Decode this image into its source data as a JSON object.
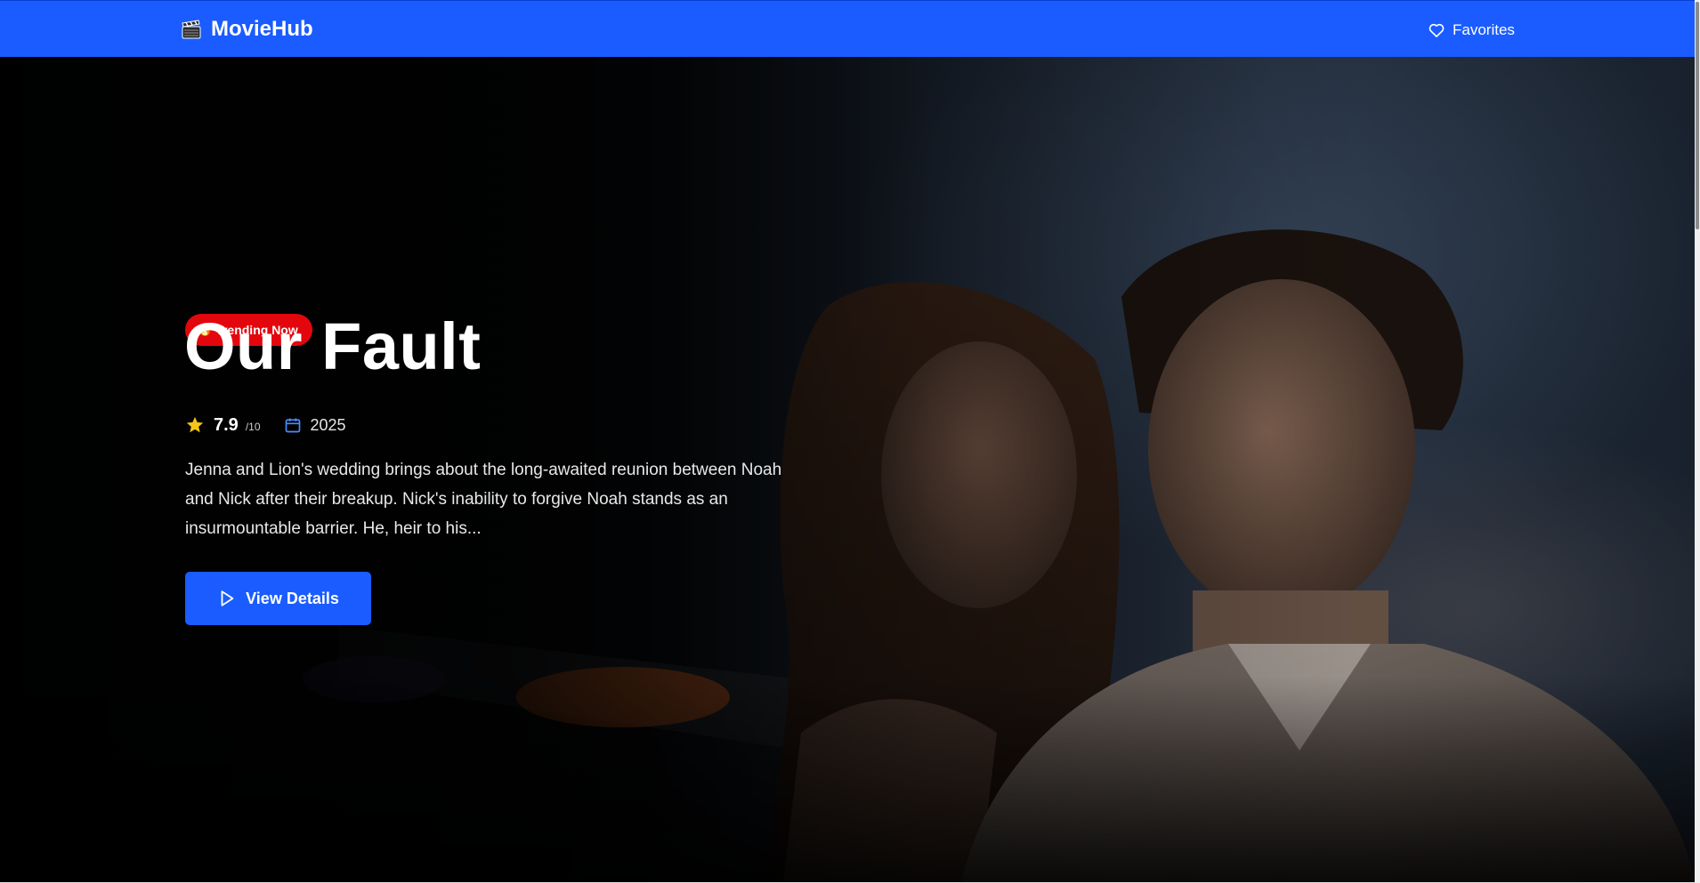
{
  "nav": {
    "brand": "MovieHub",
    "favorites_label": "Favorites"
  },
  "hero": {
    "badge": "Trending Now",
    "title": "Our Fault",
    "rating": "7.9",
    "rating_scale": "/10",
    "year": "2025",
    "description": "Jenna and Lion's wedding brings about the long-awaited reunion between Noah and Nick after their breakup. Nick's inability to forgive Noah stands as an insurmountable barrier. He, heir to his...",
    "cta_label": "View Details"
  },
  "icons": {
    "brand": "clapperboard-icon",
    "favorites": "heart-icon",
    "badge": "fire-icon",
    "rating": "star-icon",
    "year": "calendar-icon",
    "cta": "play-icon"
  },
  "colors": {
    "primary": "#1a5cff",
    "badge": "#e3070d",
    "star": "#f5c518"
  }
}
